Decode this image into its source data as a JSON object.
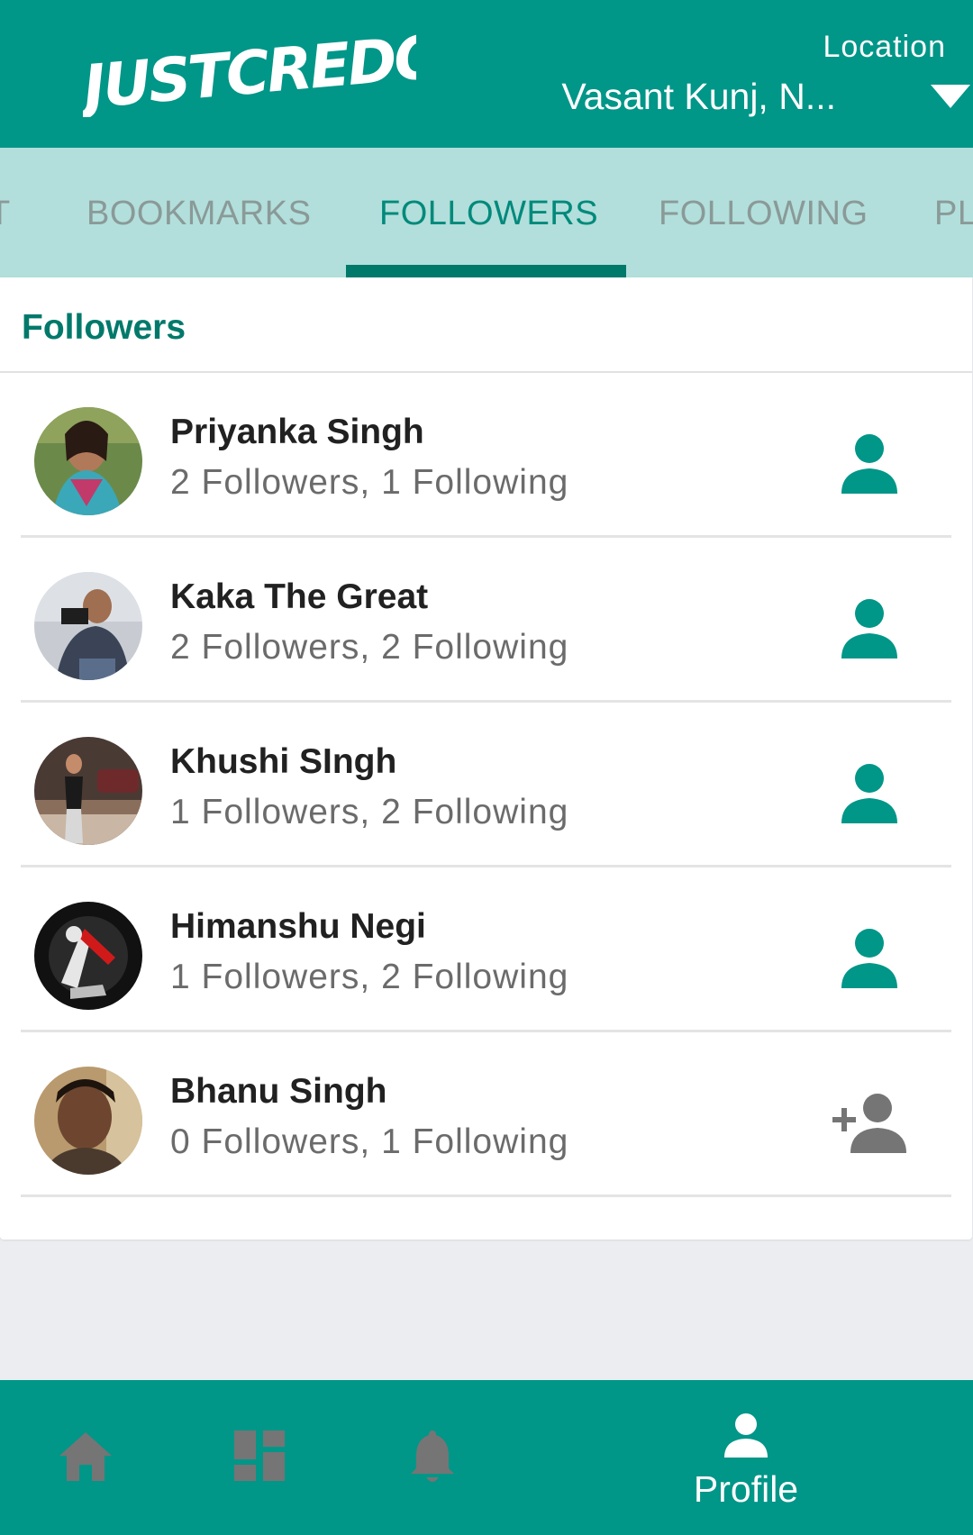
{
  "header": {
    "logo_text": "JUSTCREDO",
    "location_label": "Location",
    "location_value": "Vasant Kunj, N...",
    "dropdown_icon": "triangle-down-icon"
  },
  "tabs": [
    {
      "label": "BOOKMARKS",
      "active": false
    },
    {
      "label": "FOLLOWERS",
      "active": true
    },
    {
      "label": "FOLLOWING",
      "active": false
    },
    {
      "label": "PL",
      "active": false
    }
  ],
  "section": {
    "title": "Followers"
  },
  "followers": [
    {
      "name": "Priyanka Singh",
      "stats": "2 Followers, 1 Following",
      "action_icon": "person-icon",
      "following": true
    },
    {
      "name": "Kaka The Great",
      "stats": "2 Followers, 2 Following",
      "action_icon": "person-icon",
      "following": true
    },
    {
      "name": "Khushi SIngh",
      "stats": "1 Followers, 2 Following",
      "action_icon": "person-icon",
      "following": true
    },
    {
      "name": "Himanshu Negi",
      "stats": "1 Followers, 2 Following",
      "action_icon": "person-icon",
      "following": true
    },
    {
      "name": "Bhanu Singh",
      "stats": "0 Followers, 1 Following",
      "action_icon": "person-add-icon",
      "following": false
    }
  ],
  "bottom_nav": [
    {
      "icon": "home-icon",
      "label": "",
      "active": false
    },
    {
      "icon": "dashboard-icon",
      "label": "",
      "active": false
    },
    {
      "icon": "bell-icon",
      "label": "",
      "active": false
    },
    {
      "icon": "person-icon",
      "label": "Profile",
      "active": true
    }
  ],
  "colors": {
    "primary": "#009688",
    "tab_bar": "#b2dfdb",
    "accent_dark": "#00796b",
    "inactive_icon": "#757575"
  }
}
